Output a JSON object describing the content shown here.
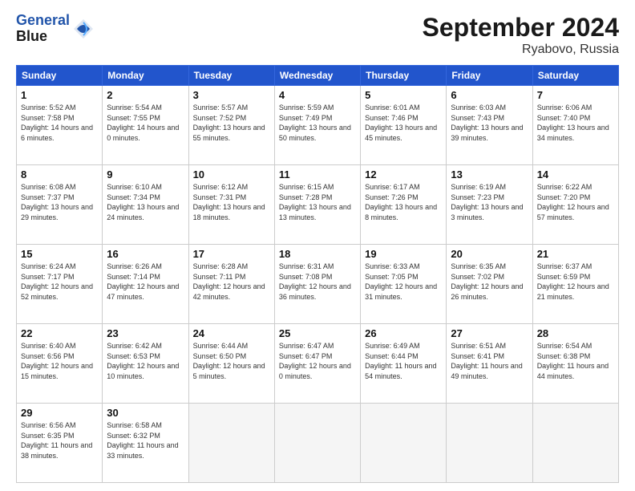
{
  "header": {
    "logo_line1": "General",
    "logo_line2": "Blue",
    "month_title": "September 2024",
    "location": "Ryabovo, Russia"
  },
  "weekdays": [
    "Sunday",
    "Monday",
    "Tuesday",
    "Wednesday",
    "Thursday",
    "Friday",
    "Saturday"
  ],
  "weeks": [
    [
      {
        "day": "1",
        "sunrise": "Sunrise: 5:52 AM",
        "sunset": "Sunset: 7:58 PM",
        "daylight": "Daylight: 14 hours and 6 minutes."
      },
      {
        "day": "2",
        "sunrise": "Sunrise: 5:54 AM",
        "sunset": "Sunset: 7:55 PM",
        "daylight": "Daylight: 14 hours and 0 minutes."
      },
      {
        "day": "3",
        "sunrise": "Sunrise: 5:57 AM",
        "sunset": "Sunset: 7:52 PM",
        "daylight": "Daylight: 13 hours and 55 minutes."
      },
      {
        "day": "4",
        "sunrise": "Sunrise: 5:59 AM",
        "sunset": "Sunset: 7:49 PM",
        "daylight": "Daylight: 13 hours and 50 minutes."
      },
      {
        "day": "5",
        "sunrise": "Sunrise: 6:01 AM",
        "sunset": "Sunset: 7:46 PM",
        "daylight": "Daylight: 13 hours and 45 minutes."
      },
      {
        "day": "6",
        "sunrise": "Sunrise: 6:03 AM",
        "sunset": "Sunset: 7:43 PM",
        "daylight": "Daylight: 13 hours and 39 minutes."
      },
      {
        "day": "7",
        "sunrise": "Sunrise: 6:06 AM",
        "sunset": "Sunset: 7:40 PM",
        "daylight": "Daylight: 13 hours and 34 minutes."
      }
    ],
    [
      {
        "day": "8",
        "sunrise": "Sunrise: 6:08 AM",
        "sunset": "Sunset: 7:37 PM",
        "daylight": "Daylight: 13 hours and 29 minutes."
      },
      {
        "day": "9",
        "sunrise": "Sunrise: 6:10 AM",
        "sunset": "Sunset: 7:34 PM",
        "daylight": "Daylight: 13 hours and 24 minutes."
      },
      {
        "day": "10",
        "sunrise": "Sunrise: 6:12 AM",
        "sunset": "Sunset: 7:31 PM",
        "daylight": "Daylight: 13 hours and 18 minutes."
      },
      {
        "day": "11",
        "sunrise": "Sunrise: 6:15 AM",
        "sunset": "Sunset: 7:28 PM",
        "daylight": "Daylight: 13 hours and 13 minutes."
      },
      {
        "day": "12",
        "sunrise": "Sunrise: 6:17 AM",
        "sunset": "Sunset: 7:26 PM",
        "daylight": "Daylight: 13 hours and 8 minutes."
      },
      {
        "day": "13",
        "sunrise": "Sunrise: 6:19 AM",
        "sunset": "Sunset: 7:23 PM",
        "daylight": "Daylight: 13 hours and 3 minutes."
      },
      {
        "day": "14",
        "sunrise": "Sunrise: 6:22 AM",
        "sunset": "Sunset: 7:20 PM",
        "daylight": "Daylight: 12 hours and 57 minutes."
      }
    ],
    [
      {
        "day": "15",
        "sunrise": "Sunrise: 6:24 AM",
        "sunset": "Sunset: 7:17 PM",
        "daylight": "Daylight: 12 hours and 52 minutes."
      },
      {
        "day": "16",
        "sunrise": "Sunrise: 6:26 AM",
        "sunset": "Sunset: 7:14 PM",
        "daylight": "Daylight: 12 hours and 47 minutes."
      },
      {
        "day": "17",
        "sunrise": "Sunrise: 6:28 AM",
        "sunset": "Sunset: 7:11 PM",
        "daylight": "Daylight: 12 hours and 42 minutes."
      },
      {
        "day": "18",
        "sunrise": "Sunrise: 6:31 AM",
        "sunset": "Sunset: 7:08 PM",
        "daylight": "Daylight: 12 hours and 36 minutes."
      },
      {
        "day": "19",
        "sunrise": "Sunrise: 6:33 AM",
        "sunset": "Sunset: 7:05 PM",
        "daylight": "Daylight: 12 hours and 31 minutes."
      },
      {
        "day": "20",
        "sunrise": "Sunrise: 6:35 AM",
        "sunset": "Sunset: 7:02 PM",
        "daylight": "Daylight: 12 hours and 26 minutes."
      },
      {
        "day": "21",
        "sunrise": "Sunrise: 6:37 AM",
        "sunset": "Sunset: 6:59 PM",
        "daylight": "Daylight: 12 hours and 21 minutes."
      }
    ],
    [
      {
        "day": "22",
        "sunrise": "Sunrise: 6:40 AM",
        "sunset": "Sunset: 6:56 PM",
        "daylight": "Daylight: 12 hours and 15 minutes."
      },
      {
        "day": "23",
        "sunrise": "Sunrise: 6:42 AM",
        "sunset": "Sunset: 6:53 PM",
        "daylight": "Daylight: 12 hours and 10 minutes."
      },
      {
        "day": "24",
        "sunrise": "Sunrise: 6:44 AM",
        "sunset": "Sunset: 6:50 PM",
        "daylight": "Daylight: 12 hours and 5 minutes."
      },
      {
        "day": "25",
        "sunrise": "Sunrise: 6:47 AM",
        "sunset": "Sunset: 6:47 PM",
        "daylight": "Daylight: 12 hours and 0 minutes."
      },
      {
        "day": "26",
        "sunrise": "Sunrise: 6:49 AM",
        "sunset": "Sunset: 6:44 PM",
        "daylight": "Daylight: 11 hours and 54 minutes."
      },
      {
        "day": "27",
        "sunrise": "Sunrise: 6:51 AM",
        "sunset": "Sunset: 6:41 PM",
        "daylight": "Daylight: 11 hours and 49 minutes."
      },
      {
        "day": "28",
        "sunrise": "Sunrise: 6:54 AM",
        "sunset": "Sunset: 6:38 PM",
        "daylight": "Daylight: 11 hours and 44 minutes."
      }
    ],
    [
      {
        "day": "29",
        "sunrise": "Sunrise: 6:56 AM",
        "sunset": "Sunset: 6:35 PM",
        "daylight": "Daylight: 11 hours and 38 minutes."
      },
      {
        "day": "30",
        "sunrise": "Sunrise: 6:58 AM",
        "sunset": "Sunset: 6:32 PM",
        "daylight": "Daylight: 11 hours and 33 minutes."
      },
      null,
      null,
      null,
      null,
      null
    ]
  ]
}
